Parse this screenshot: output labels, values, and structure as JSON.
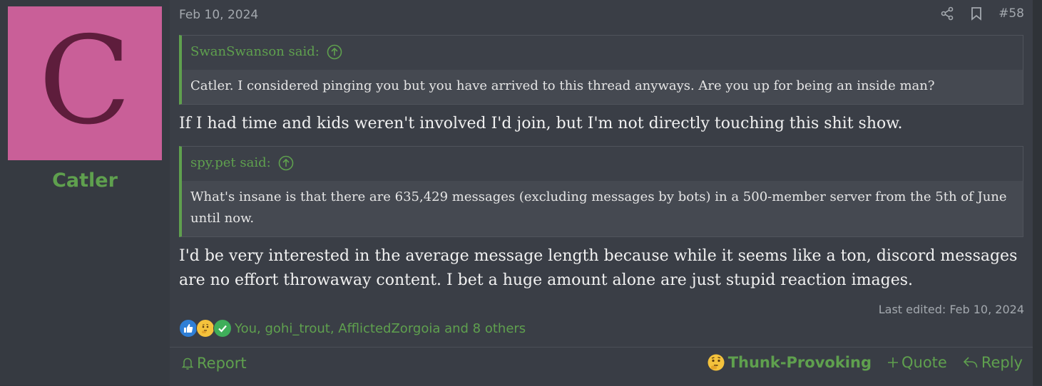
{
  "user": {
    "avatar_letter": "C",
    "avatar_color": "#c95f98",
    "name": "Catler"
  },
  "post": {
    "date": "Feb 10, 2024",
    "number": "#58",
    "quotes": [
      {
        "author": "SwanSwanson said:",
        "text": "Catler. I considered pinging you but you have arrived to this thread anyways. Are you up for being an inside man?"
      },
      {
        "author": "spy.pet said:",
        "text": "What's insane is that there are 635,429 messages (excluding messages by bots) in a 500-member server from the 5th of June until now."
      }
    ],
    "messages": [
      "If I had time and kids weren't involved I'd join, but I'm not directly touching this shit show.",
      "I'd be very interested in the average message length because while it seems like a ton, discord messages are no effort throwaway content. I bet a huge amount alone are just stupid reaction images."
    ],
    "last_edited": "Last edited: Feb 10, 2024",
    "reactions_text": "You, gohi_trout, AfflictedZorgoia and 8 others",
    "reaction_icons": [
      "like-icon",
      "thinking-face-icon",
      "checkmark-icon"
    ]
  },
  "footer": {
    "report_label": "Report",
    "reaction_label": "Thunk-Provoking",
    "quote_label": "Quote",
    "reply_label": "Reply"
  },
  "colors": {
    "accent": "#5fa04e",
    "background": "#3a3e46"
  }
}
